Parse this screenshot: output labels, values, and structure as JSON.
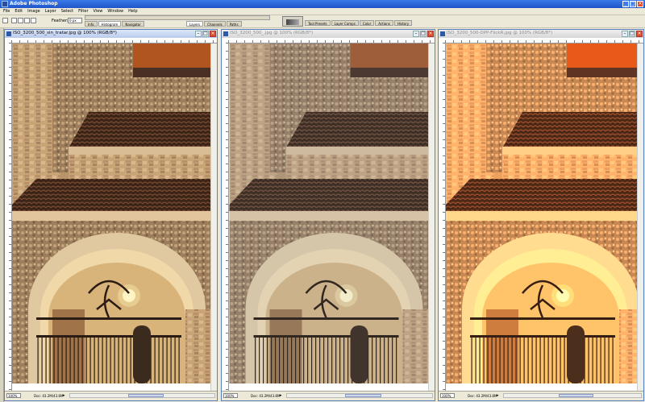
{
  "app": {
    "title": "Adobe Photoshop",
    "window_buttons": [
      "_",
      "□",
      "×"
    ]
  },
  "menu": [
    "File",
    "Edit",
    "Image",
    "Layer",
    "Select",
    "Filter",
    "View",
    "Window",
    "Help"
  ],
  "options_bar": {
    "feather_label": "Feather:",
    "feather_value": "0 px"
  },
  "palette_dock": {
    "upper_tabs": [
      "Info",
      "Histogram",
      "Navigator"
    ],
    "lower_tabs": [
      "Layers",
      "Channels",
      "Paths"
    ]
  },
  "right_tabs": [
    "Tool Presets",
    "Layer Comps",
    "Color",
    "Actions",
    "History"
  ],
  "documents": [
    {
      "title": "ISO_3200_500_sin_tratar.jpg @ 100% (RGB/8*)",
      "zoom": "100%",
      "doc_size": "Doc: 43.2M/43.8M",
      "tone": "neutral"
    },
    {
      "title": "ISO_3200_500_.jpg @ 100% (RGB/8*)",
      "zoom": "100%",
      "doc_size": "Doc: 43.2M/43.8M",
      "tone": "muted"
    },
    {
      "title": "ISO_3200_500-DPP-FlickR.jpg @ 100% (RGB/8*)",
      "zoom": "100%",
      "doc_size": "Doc: 43.2M/43.8M",
      "tone": "warm"
    }
  ],
  "colors": {
    "titlebar": "#2a62d8",
    "workspace": "#ece9d8"
  }
}
